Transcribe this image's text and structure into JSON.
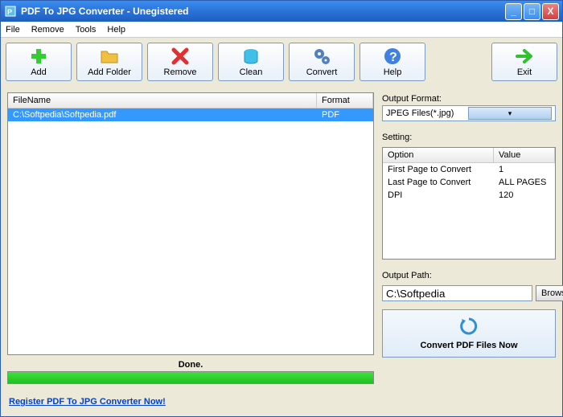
{
  "titlebar": {
    "title": "PDF To JPG Converter - Unegistered"
  },
  "menubar": {
    "file": "File",
    "remove": "Remove",
    "tools": "Tools",
    "help": "Help"
  },
  "toolbar": {
    "add": "Add",
    "add_folder": "Add Folder",
    "remove": "Remove",
    "clean": "Clean",
    "convert": "Convert",
    "help": "Help",
    "exit": "Exit"
  },
  "file_list": {
    "header_filename": "FileName",
    "header_format": "Format",
    "rows": [
      {
        "filename": "C:\\Softpedia\\Softpedia.pdf",
        "format": "PDF"
      }
    ]
  },
  "status": "Done.",
  "register_link": "Register PDF To JPG Converter Now!",
  "right": {
    "output_format_label": "Output Format:",
    "output_format_value": "JPEG Files(*.jpg)",
    "setting_label": "Setting:",
    "setting_header_option": "Option",
    "setting_header_value": "Value",
    "settings": [
      {
        "option": "First Page to Convert",
        "value": "1"
      },
      {
        "option": "Last Page to Convert",
        "value": "ALL PAGES"
      },
      {
        "option": "DPI",
        "value": "120"
      }
    ],
    "output_path_label": "Output Path:",
    "output_path_value": "C:\\Softpedia",
    "browse": "Browse",
    "convert_btn": "Convert PDF Files Now"
  }
}
